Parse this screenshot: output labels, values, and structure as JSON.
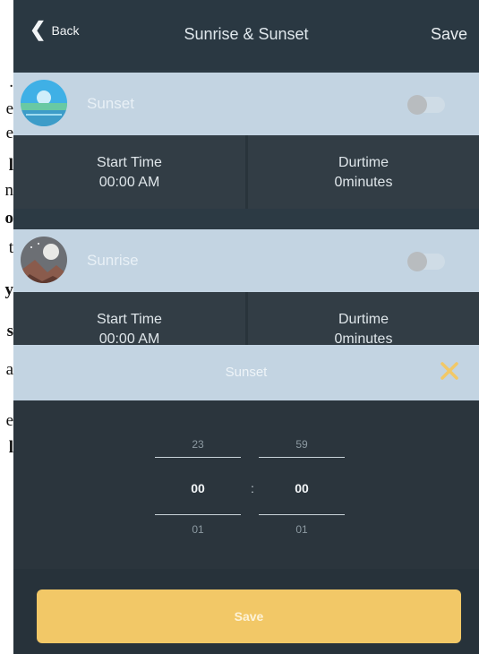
{
  "left_fragments": [
    ".",
    "e",
    "e",
    "l",
    "n",
    "o",
    "t",
    "y",
    "s",
    "a",
    "e",
    "l"
  ],
  "header": {
    "back_label": "Back",
    "title": "Sunrise & Sunset",
    "save_label": "Save"
  },
  "schedules": [
    {
      "name": "Sunset",
      "enabled": false,
      "start_time_label": "Start Time",
      "start_time": "00:00 AM",
      "duration_label": "Durtime",
      "duration": "0minutes"
    },
    {
      "name": "Sunrise",
      "enabled": false,
      "start_time_label": "Start Time",
      "start_time": "00:00 AM",
      "duration_label": "Durtime",
      "duration": "0minutes"
    }
  ],
  "picker": {
    "title": "Sunset",
    "hours": {
      "above": "23",
      "selected": "00",
      "below": "01"
    },
    "minutes": {
      "above": "59",
      "selected": "00",
      "below": "01"
    },
    "separator": ":",
    "save_label": "Save"
  },
  "colors": {
    "accent": "#f2c867",
    "header_band": "#c3d4e2",
    "panel": "#323d45"
  }
}
